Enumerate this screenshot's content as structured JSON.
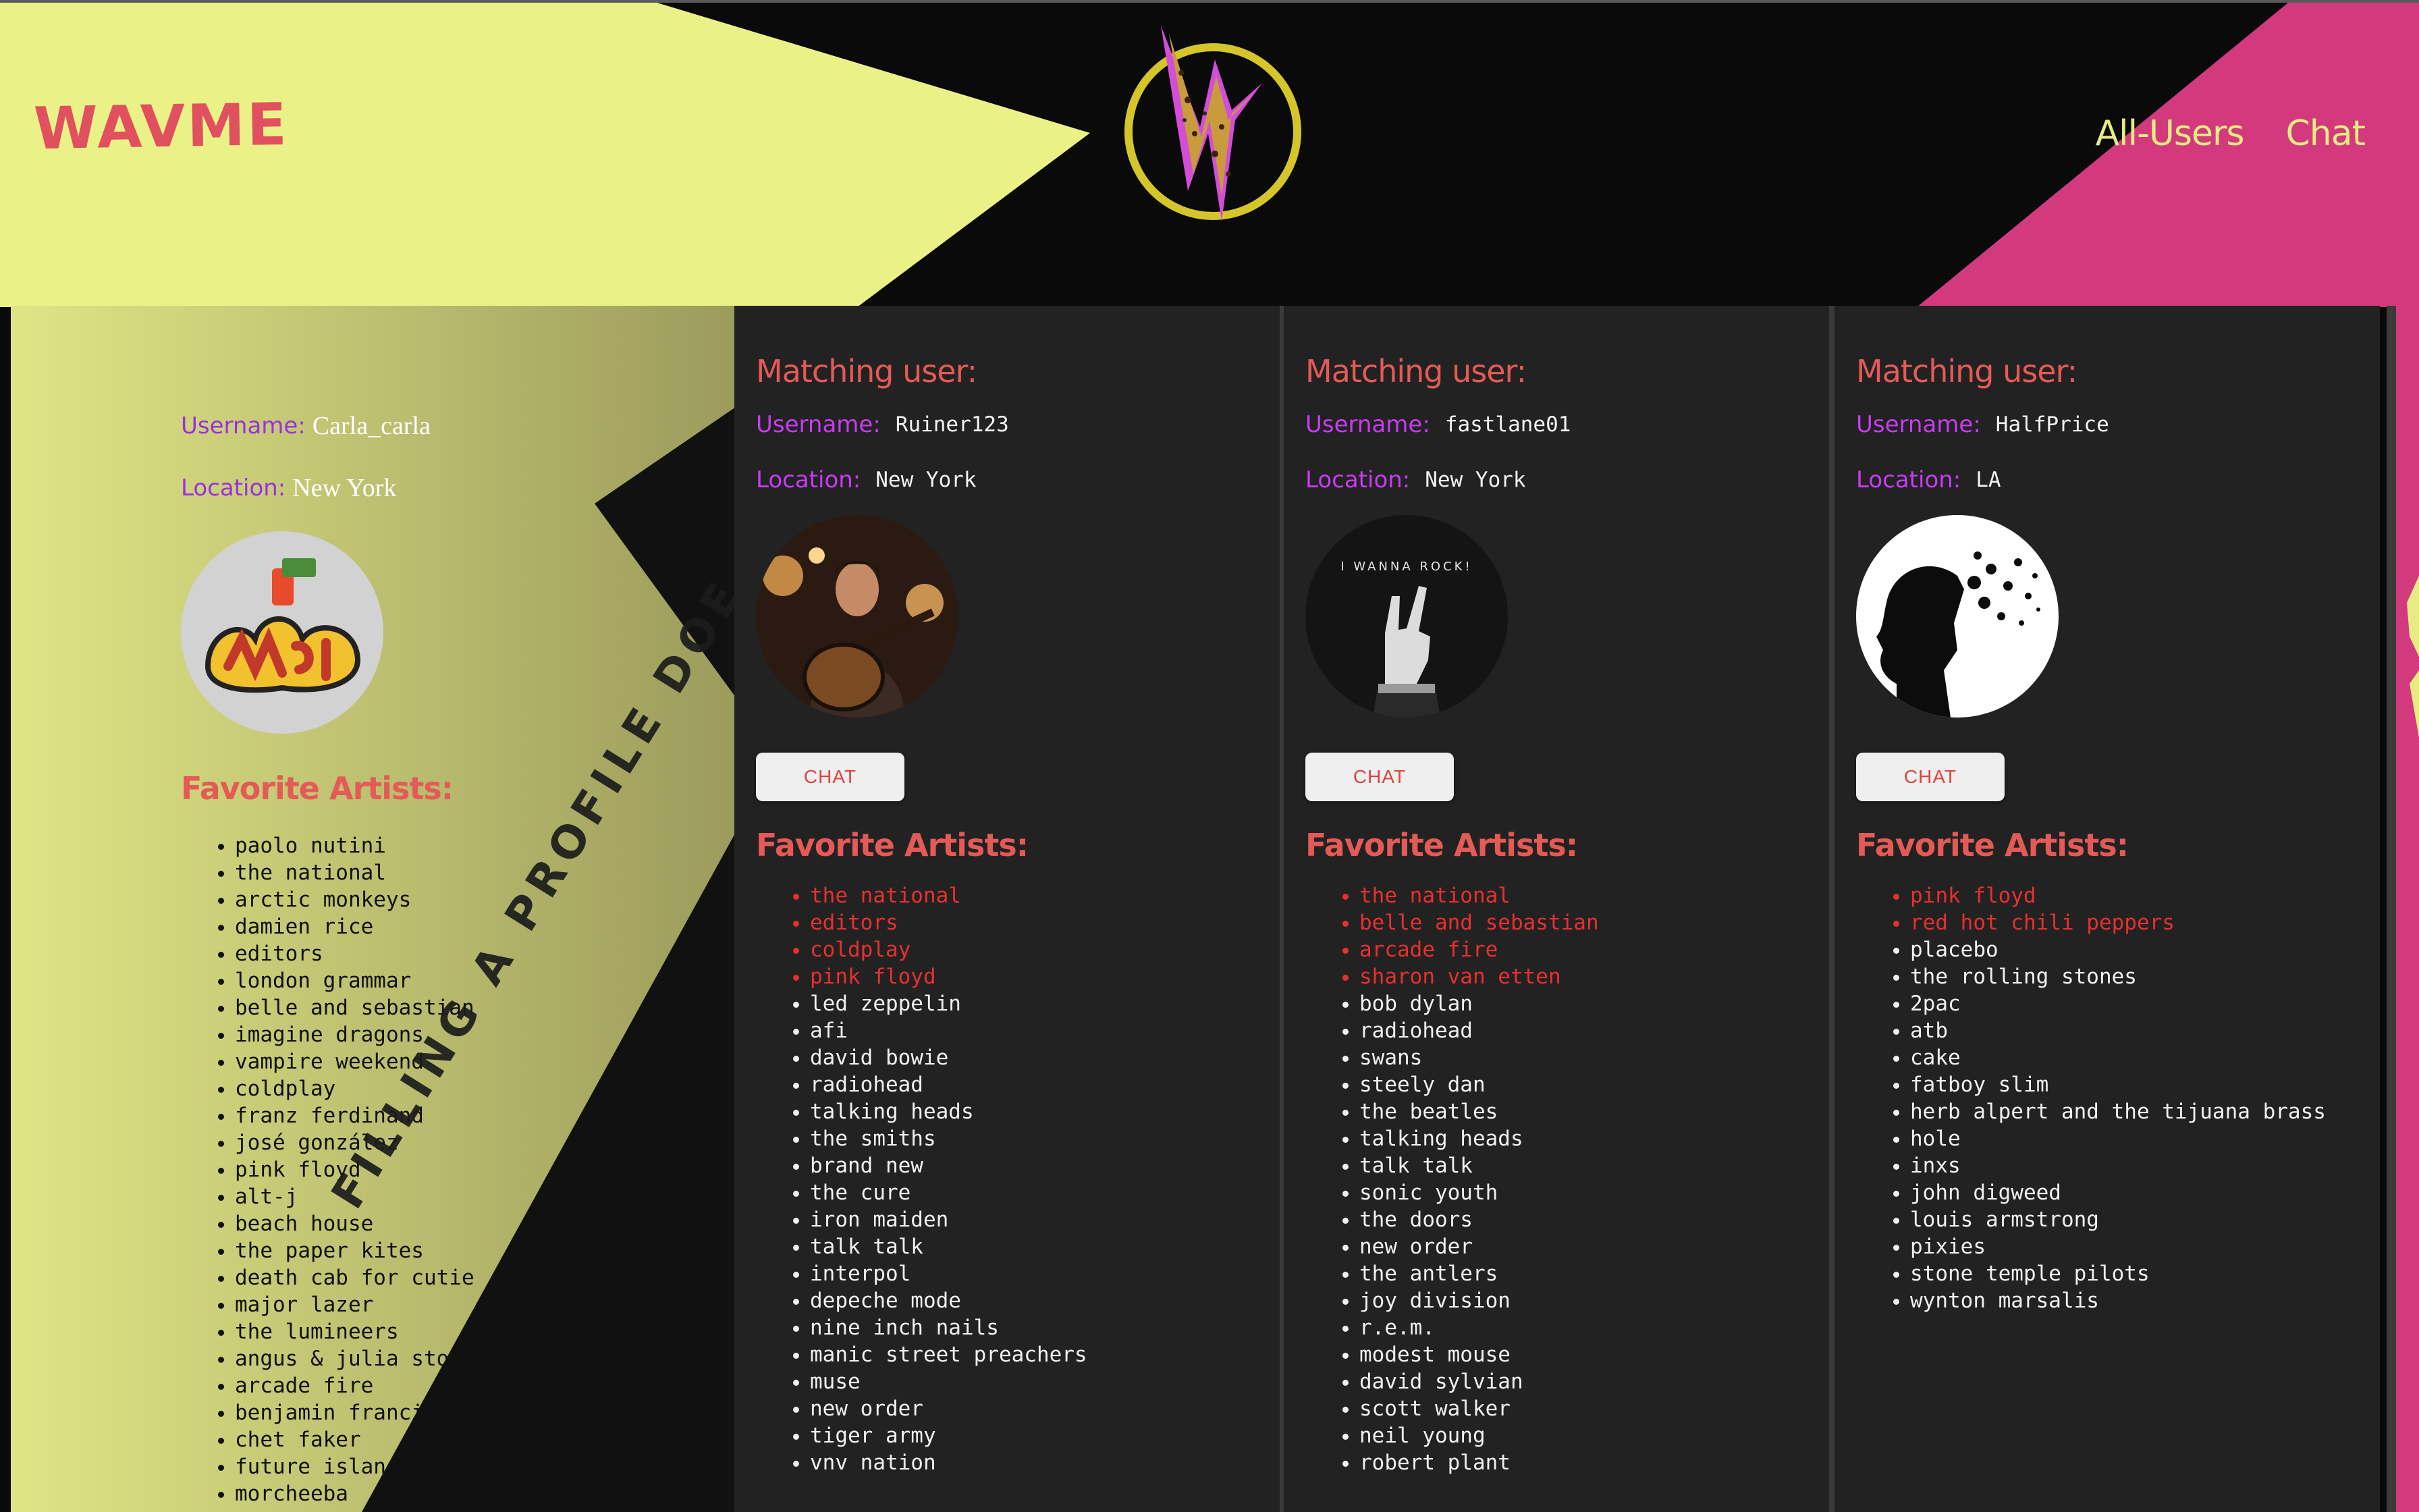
{
  "header": {
    "brand": "WAVME",
    "logo_icon": "wavme-w-logo",
    "nav": [
      "All-Users",
      "Chat"
    ],
    "colors": {
      "yellow": "#eaf287",
      "pink": "#d33a7e",
      "black": "#0a0a0b",
      "brand_red": "#e0505e"
    }
  },
  "own_profile": {
    "username_label": "Username:",
    "username": "Carla_carla",
    "location_label": "Location:",
    "location": "New York",
    "avatar_icon": "music-graffiti-avatar",
    "favorites_title": "Favorite Artists:",
    "artists": [
      "paolo nutini",
      "the national",
      "arctic monkeys",
      "damien rice",
      "editors",
      "london grammar",
      "belle and sebastian",
      "imagine dragons",
      "vampire weekend",
      "coldplay",
      "franz ferdinand",
      "josé gonzález",
      "pink floyd",
      "alt-j",
      "beach house",
      "the paper kites",
      "death cab for cutie",
      "major lazer",
      "the lumineers",
      "angus & julia stone",
      "arcade fire",
      "benjamin francis leftwich",
      "chet faker",
      "future islands",
      "morcheeba"
    ],
    "stamp_text": "FILLING A PROFILE DOE"
  },
  "matches": [
    {
      "heading": "Matching user:",
      "username_label": "Username:",
      "username": "Ruiner123",
      "location_label": "Location:",
      "location": "New York",
      "avatar_icon": "guitarist-photo-avatar",
      "chat_label": "CHAT",
      "favorites_title": "Favorite Artists:",
      "matched_artists": [
        "the national",
        "editors",
        "coldplay",
        "pink floyd"
      ],
      "other_artists": [
        "led zeppelin",
        "afi",
        "david bowie",
        "radiohead",
        "talking heads",
        "the smiths",
        "brand new",
        "the cure",
        "iron maiden",
        "talk talk",
        "interpol",
        "depeche mode",
        "nine inch nails",
        "manic street preachers",
        "muse",
        "new order",
        "tiger army",
        "vnv nation"
      ]
    },
    {
      "heading": "Matching user:",
      "username_label": "Username:",
      "username": "fastlane01",
      "location_label": "Location:",
      "location": "New York",
      "avatar_icon": "rock-hand-avatar",
      "avatar_caption": "I WANNA ROCK!",
      "chat_label": "CHAT",
      "favorites_title": "Favorite Artists:",
      "matched_artists": [
        "the national",
        "belle and sebastian",
        "arcade fire",
        "sharon van etten"
      ],
      "other_artists": [
        "bob dylan",
        "radiohead",
        "swans",
        "steely dan",
        "the beatles",
        "talking heads",
        "talk talk",
        "sonic youth",
        "the doors",
        "new order",
        "the antlers",
        "joy division",
        "r.e.m.",
        "modest mouse",
        "david sylvian",
        "scott walker",
        "neil young",
        "robert plant"
      ]
    },
    {
      "heading": "Matching user:",
      "username_label": "Username:",
      "username": "HalfPrice",
      "location_label": "Location:",
      "location": "LA",
      "avatar_icon": "head-silhouette-music-avatar",
      "chat_label": "CHAT",
      "favorites_title": "Favorite Artists:",
      "matched_artists": [
        "pink floyd",
        "red hot chili peppers"
      ],
      "other_artists": [
        "placebo",
        "the rolling stones",
        "2pac",
        "atb",
        "cake",
        "fatboy slim",
        "herb alpert and the tijuana brass",
        "hole",
        "inxs",
        "john digweed",
        "louis armstrong",
        "pixies",
        "stone temple pilots",
        "wynton marsalis"
      ]
    }
  ]
}
